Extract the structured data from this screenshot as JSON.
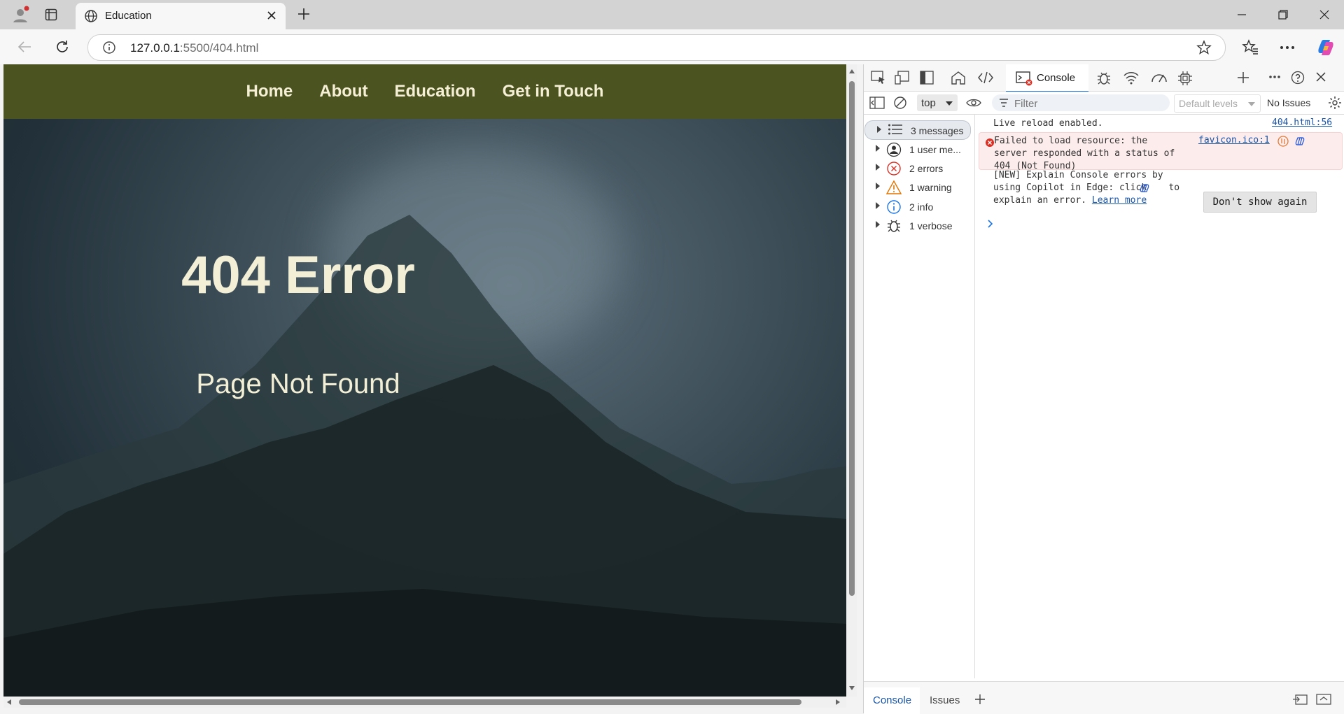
{
  "browser": {
    "tab_title": "Education",
    "url_host": "127.0.0.1",
    "url_rest": ":5500/404.html"
  },
  "page": {
    "nav": [
      "Home",
      "About",
      "Education",
      "Get in Touch"
    ],
    "error_title": "404 Error",
    "error_subtitle": "Page Not Found",
    "nav_color": "#4b5320",
    "text_color": "#f2efd6"
  },
  "devtools": {
    "active_tab": "Console",
    "context": "top",
    "filter_placeholder": "Filter",
    "levels": "Default levels",
    "issues": "No Issues",
    "sidebar": [
      {
        "label": "3 messages",
        "icon": "list-icon"
      },
      {
        "label": "1 user me...",
        "icon": "user-icon"
      },
      {
        "label": "2 errors",
        "icon": "error-icon"
      },
      {
        "label": "1 warning",
        "icon": "warning-icon"
      },
      {
        "label": "2 info",
        "icon": "info-icon"
      },
      {
        "label": "1 verbose",
        "icon": "bug-icon"
      }
    ],
    "messages": {
      "reload": "Live reload enabled.",
      "reload_src": "404.html:56",
      "error_line1": "Failed to load resource: the",
      "error_line2": "server responded with a status of",
      "error_line3": "404 (Not Found)",
      "error_src": "favicon.ico:1",
      "copilot_line1": "[NEW] Explain Console errors by",
      "copilot_line2a": "using Copilot in Edge: click",
      "copilot_line2b": "to",
      "copilot_line3": "explain an error.",
      "learn_more": "Learn more",
      "dont_show": "Don't show again"
    },
    "bottom_tabs": [
      "Console",
      "Issues"
    ]
  }
}
